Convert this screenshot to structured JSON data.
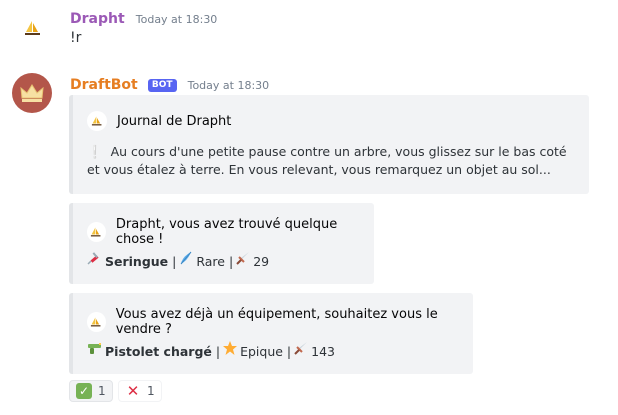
{
  "message1": {
    "username": "Drapht",
    "timestamp": "Today at 18:30",
    "content": "!r"
  },
  "message2": {
    "username": "DraftBot",
    "bot_label": "BOT",
    "timestamp": "Today at 18:30",
    "embeds": [
      {
        "title": "Journal de Drapht",
        "description": "Au cours d'une petite pause contre un arbre, vous glissez sur le bas coté et vous étalez à terre. En vous relevant, vous remarquez un objet au sol..."
      },
      {
        "title": "Drapht, vous avez trouvé quelque chose !",
        "item_name": "Seringue",
        "rarity": "Rare",
        "attack": "29",
        "separator": "|"
      },
      {
        "title": "Vous avez déjà un équipement, souhaitez vous le vendre ?",
        "item_name": "Pistolet chargé",
        "rarity": "Epique",
        "attack": "143",
        "separator": "|"
      }
    ],
    "reactions": [
      {
        "emoji": "check-mark",
        "count": "1",
        "color": "#77b255"
      },
      {
        "emoji": "cross-mark",
        "count": "1",
        "color": "#dd2e44"
      }
    ]
  },
  "colors": {
    "drapht_name": "#9b59b6",
    "draftbot_name": "#e67e22",
    "bot_tag": "#5865f2",
    "embed_bg": "#f2f3f5",
    "draftbot_avatar": "#b3564a"
  }
}
